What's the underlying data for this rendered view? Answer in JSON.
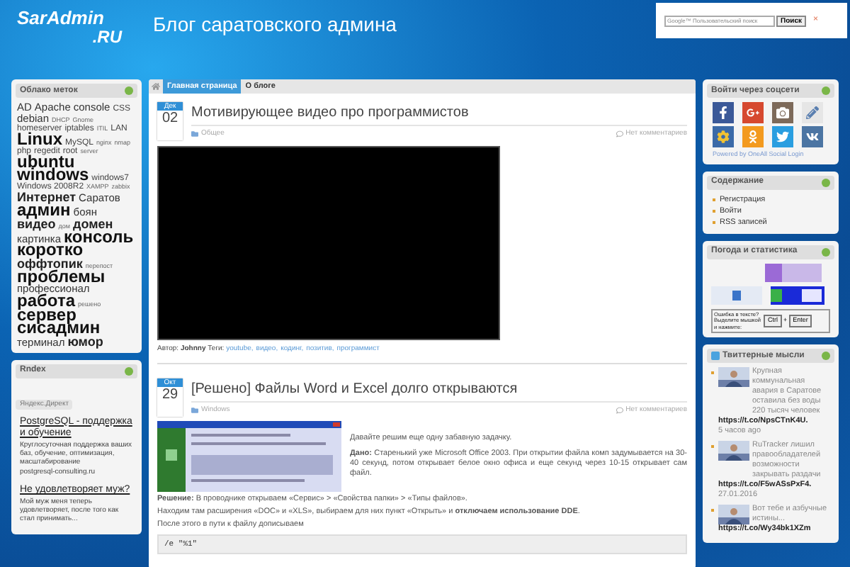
{
  "header": {
    "logo_top": "SarAdmin",
    "logo_bottom": ".RU",
    "title": "Блог саратовского админа",
    "search": {
      "placeholder": "Google™ Пользовательский поиск",
      "button": "Поиск",
      "close": "×"
    }
  },
  "tag_cloud": {
    "title": "Облако меток",
    "tags": [
      {
        "label": "AD",
        "kind": "m"
      },
      {
        "label": "Apache",
        "kind": "m"
      },
      {
        "label": "console",
        "kind": "m"
      },
      {
        "label": "CSS",
        "kind": "s"
      },
      {
        "label": "debian",
        "kind": "m"
      },
      {
        "label": "DHCP",
        "kind": "xs"
      },
      {
        "label": "Gnome",
        "kind": "xs"
      },
      {
        "label": "homeserver",
        "kind": "s"
      },
      {
        "label": "iptables",
        "kind": "s"
      },
      {
        "label": "ITIL",
        "kind": "xs"
      },
      {
        "label": "LAN",
        "kind": "s"
      },
      {
        "label": "Linux",
        "kind": "xl"
      },
      {
        "label": "MySQL",
        "kind": "s"
      },
      {
        "label": "nginx",
        "kind": "xs"
      },
      {
        "label": "nmap",
        "kind": "xs"
      },
      {
        "label": "php",
        "kind": "s"
      },
      {
        "label": "regedit",
        "kind": "s"
      },
      {
        "label": "root",
        "kind": "s"
      },
      {
        "label": "server",
        "kind": "xs"
      },
      {
        "label": "ubuntu",
        "kind": "xl"
      },
      {
        "label": "windows",
        "kind": "xl"
      },
      {
        "label": "windows7",
        "kind": "s"
      },
      {
        "label": "Windows 2008R2",
        "kind": "s"
      },
      {
        "label": "XAMPP",
        "kind": "xs"
      },
      {
        "label": "zabbix",
        "kind": "xs"
      },
      {
        "label": "Интернет",
        "kind": "l"
      },
      {
        "label": "Саратов",
        "kind": "m"
      },
      {
        "label": "админ",
        "kind": "xl"
      },
      {
        "label": "боян",
        "kind": "m"
      },
      {
        "label": "видео",
        "kind": "l"
      },
      {
        "label": "дом",
        "kind": "xs"
      },
      {
        "label": "домен",
        "kind": "l"
      },
      {
        "label": "картинка",
        "kind": "m"
      },
      {
        "label": "консоль",
        "kind": "xl"
      },
      {
        "label": "коротко",
        "kind": "xl"
      },
      {
        "label": "оффтопик",
        "kind": "l"
      },
      {
        "label": "перепост",
        "kind": "xs"
      },
      {
        "label": "проблемы",
        "kind": "xl"
      },
      {
        "label": "профессионал",
        "kind": "m"
      },
      {
        "label": "работа",
        "kind": "xl"
      },
      {
        "label": "решено",
        "kind": "xs"
      },
      {
        "label": "сервер",
        "kind": "xl"
      },
      {
        "label": "сисадмин",
        "kind": "xl"
      },
      {
        "label": "терминал",
        "kind": "m"
      },
      {
        "label": "юмор",
        "kind": "l"
      }
    ]
  },
  "ads": {
    "title": "Rndex",
    "label": "Яндекс.Директ",
    "items": [
      {
        "title": "PostgreSQL - поддержка и обучение",
        "text": "Круглосуточная поддержка ваших баз, обучение, оптимизация, масштабирование",
        "domain": "postgresql-consulting.ru"
      },
      {
        "title": "Не удовлетворяет муж?",
        "text": "Мой муж меня теперь удовлетворяет, после того как стал принимать..."
      }
    ]
  },
  "nav": {
    "tabs": [
      {
        "label": "Главная страница",
        "selected": true
      },
      {
        "label": "О блоге",
        "selected": false
      }
    ]
  },
  "posts": [
    {
      "kind": "video",
      "month": "Дек",
      "day": "02",
      "title": "Мотивирующее видео про программистов",
      "category": "Общее",
      "comments": "Нет комментариев",
      "meta": "Автор: **Johnny** Теги:",
      "tags": [
        "youtube,",
        "видео,",
        "кодинг,",
        "позитив,",
        "программист"
      ]
    },
    {
      "kind": "article",
      "month": "Окт",
      "day": "29",
      "title": "[Решено] Файлы Word и Excel долго открываются",
      "category": "Windows",
      "comments": "Нет комментариев",
      "intro": [
        "Давайте решим еще одну забавную задачку.",
        "**Дано:** Старенький уже Microsoft Office 2003. При открытии файла комп задумывается на 30-40 секунд, потом открывает белое окно офиса и еще секунд через 10-15 открывает сам файл."
      ],
      "paragraphs": [
        "**Решение:** В проводнике открываем «Сервис» > «Свойства папки» > «Типы файлов».",
        "Находим там расширения «DOC» и «XLS», выбираем для них пункт «Открыть» и **отключаем использование DDE**.",
        "После этого в пути к файлу дописываем"
      ],
      "code": "/e \"%1\""
    }
  ],
  "social": {
    "title": "Войти через соцсети",
    "powered": "Powered by OneAll Social Login"
  },
  "contents": {
    "title": "Содержание",
    "items": [
      "Регистрация",
      "Войти",
      "RSS записей"
    ]
  },
  "stats": {
    "title": "Погода и статистика",
    "hint": "Ошибка в тексте? Выделите мышкой и нажмите:",
    "keys": [
      "Ctrl",
      "+",
      "Enter"
    ]
  },
  "tweets": {
    "title": "Твиттерные мысли",
    "items": [
      {
        "text": "Крупная коммунальная авария в Саратове оставила без воды 220 тысяч человек",
        "link": "https://t.co/NpsCTnK4U.",
        "time": "5 часов ago"
      },
      {
        "text": "RuTracker лишил правообладателей возможности закрывать раздачи",
        "link": "https://t.co/F5wASsPxF4.",
        "time": "27.01.2016"
      },
      {
        "text": "Вот тебе и азбучные истины...",
        "link": "https://t.co/Wy34bk1XZm"
      }
    ]
  }
}
